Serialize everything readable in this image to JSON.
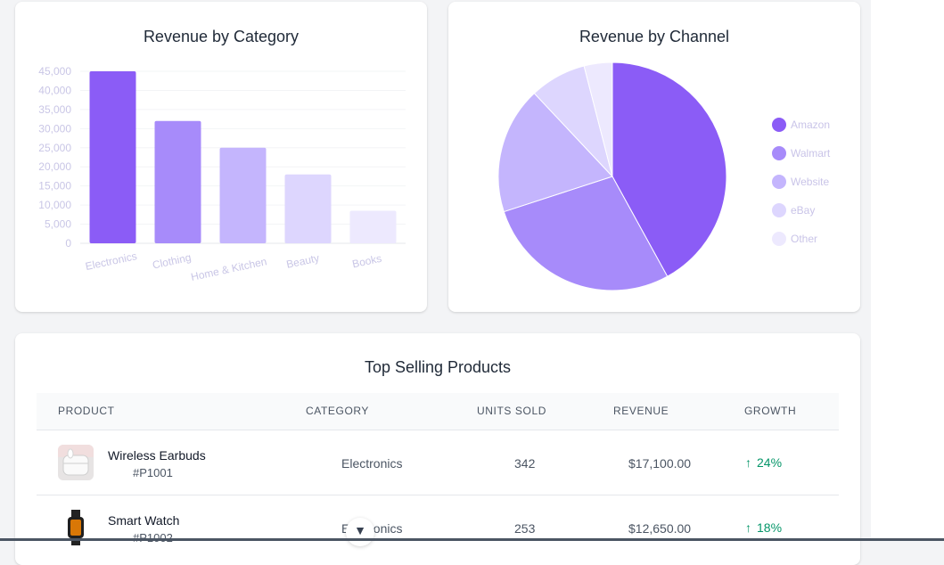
{
  "colors": {
    "bar": [
      "#8b5cf6",
      "#a78bfa",
      "#c4b5fd",
      "#ddd6fe",
      "#ede9fe"
    ],
    "pie": [
      "#8b5cf6",
      "#a78bfa",
      "#c4b5fd",
      "#ddd6fe",
      "#ede9fe"
    ],
    "growth_positive": "#059669"
  },
  "chart_data": [
    {
      "type": "bar",
      "title": "Revenue by Category",
      "categories": [
        "Electronics",
        "Clothing",
        "Home & Kitchen",
        "Beauty",
        "Books"
      ],
      "values": [
        45000,
        32000,
        25000,
        18000,
        8500
      ],
      "ylim": [
        0,
        45000
      ],
      "yticks": [
        "0",
        "5,000",
        "10,000",
        "15,000",
        "20,000",
        "25,000",
        "30,000",
        "35,000",
        "40,000",
        "45,000"
      ],
      "grid": true
    },
    {
      "type": "pie",
      "title": "Revenue by Channel",
      "categories": [
        "Amazon",
        "Walmart",
        "Website",
        "eBay",
        "Other"
      ],
      "values": [
        42,
        28,
        18,
        8,
        4
      ],
      "legend": "right"
    }
  ],
  "table": {
    "title": "Top Selling Products",
    "headers": [
      "Product",
      "Category",
      "Units Sold",
      "Revenue",
      "Growth"
    ],
    "rows": [
      {
        "name": "Wireless Earbuds",
        "sku": "#P1001",
        "category": "Electronics",
        "units": "342",
        "revenue": "$17,100.00",
        "growth": "24%",
        "icon": "earbuds-thumbnail"
      },
      {
        "name": "Smart Watch",
        "sku": "#P1002",
        "category": "Electronics",
        "units": "253",
        "revenue": "$12,650.00",
        "growth": "18%",
        "icon": "smartwatch-thumbnail"
      }
    ]
  },
  "icons": {
    "growth": "arrow-up-icon",
    "scroll": "chevron-down-icon"
  }
}
